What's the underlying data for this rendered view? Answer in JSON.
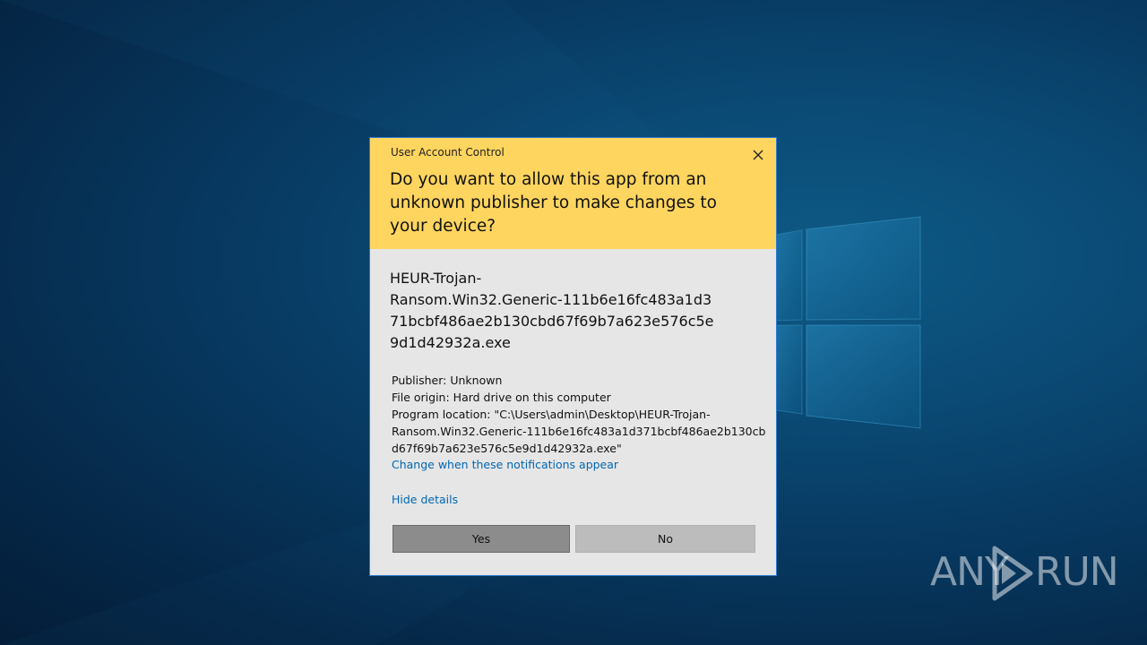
{
  "dialog": {
    "title": "User Account Control",
    "question": "Do you want to allow this app from an unknown publisher to make changes to your device?",
    "app_name_lines": [
      "HEUR-Trojan-",
      "Ransom.Win32.Generic-111b6e16fc483a1d3",
      "71bcbf486ae2b130cbd67f69b7a623e576c5e",
      "9d1d42932a.exe"
    ],
    "publisher": "Publisher: Unknown",
    "file_origin": "File origin: Hard drive on this computer",
    "program_location_lines": [
      "Program location: \"C:\\Users\\admin\\Desktop\\HEUR-Trojan-",
      "Ransom.Win32.Generic-111b6e16fc483a1d371bcbf486ae2b130cb",
      "d67f69b7a623e576c5e9d1d42932a.exe\""
    ],
    "change_link": "Change when these notifications appear",
    "hide_details": "Hide details",
    "yes_label": "Yes",
    "no_label": "No",
    "close_icon": "close-icon"
  },
  "watermark": {
    "left": "ANY",
    "right": "RUN",
    "icon": "play-icon"
  },
  "colors": {
    "header": "#fed55f",
    "body": "#e6e6e6",
    "link": "#0066b4",
    "desktop": "#0a4a75"
  }
}
